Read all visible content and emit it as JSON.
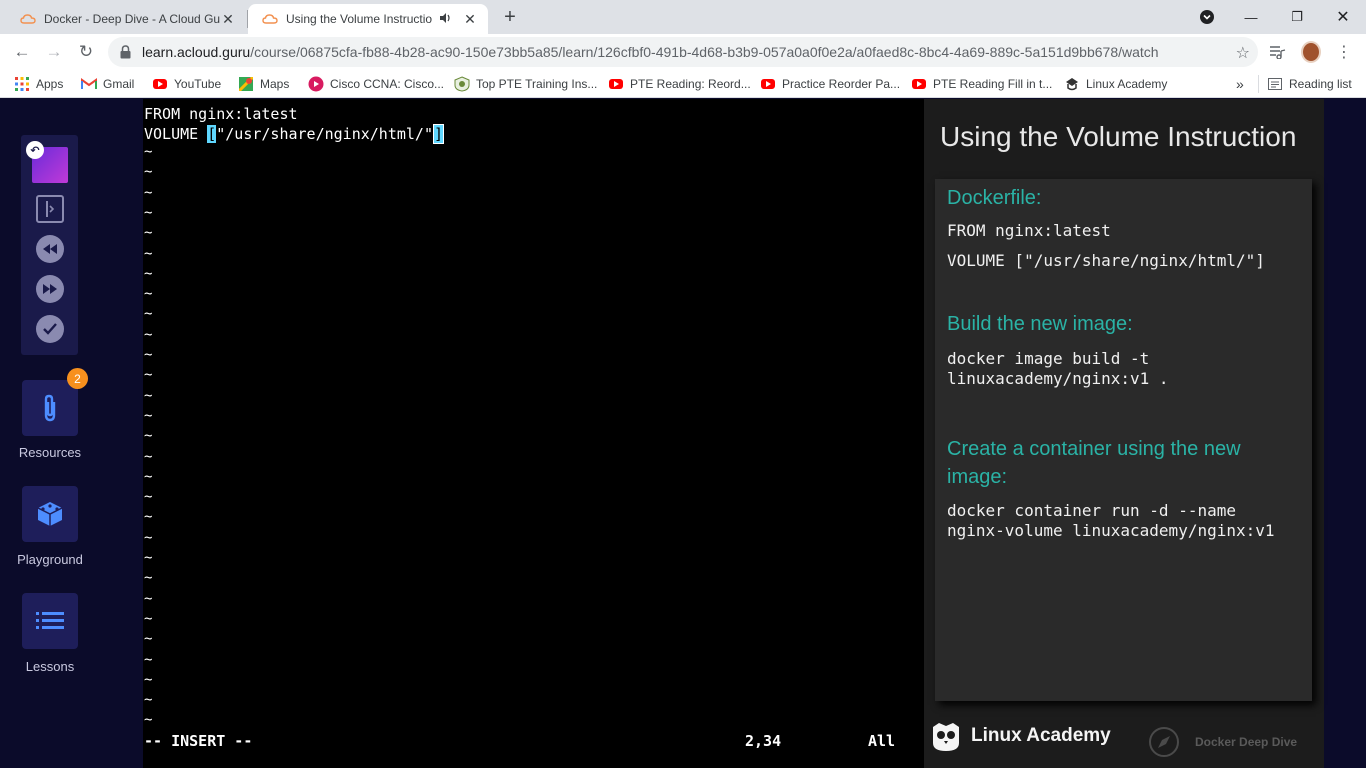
{
  "browser": {
    "tabs": [
      {
        "title": "Docker - Deep Dive - A Cloud Gu",
        "active": false
      },
      {
        "title": "Using the Volume Instructio",
        "active": true,
        "audio": true
      }
    ],
    "url_host": "learn.acloud.guru",
    "url_path": "/course/06875cfa-fb88-4b28-ac90-150e73bb5a85/learn/126cfbf0-491b-4d68-b3b9-057a0a0f0e2a/a0faed8c-8bc4-4a69-889c-5a151d9bb678/watch"
  },
  "bookmarks": {
    "items": [
      {
        "label": "Apps",
        "icon": "apps-grid-icon"
      },
      {
        "label": "Gmail",
        "icon": "gmail-icon"
      },
      {
        "label": "YouTube",
        "icon": "youtube-icon"
      },
      {
        "label": "Maps",
        "icon": "maps-icon"
      },
      {
        "label": "Cisco CCNA: Cisco...",
        "icon": "cisco-icon"
      },
      {
        "label": "Top PTE Training Ins...",
        "icon": "pte-icon"
      },
      {
        "label": "PTE Reading: Reord...",
        "icon": "youtube-icon"
      },
      {
        "label": "Practice Reorder Pa...",
        "icon": "youtube-icon"
      },
      {
        "label": "PTE Reading Fill in t...",
        "icon": "youtube-icon"
      },
      {
        "label": "Linux Academy",
        "icon": "linux-academy-icon"
      }
    ],
    "overflow": "»",
    "reading_list": "Reading list"
  },
  "leftnav": {
    "badge_count": "2",
    "resources_label": "Resources",
    "playground_label": "Playground",
    "lessons_label": "Lessons"
  },
  "terminal": {
    "line1": "FROM nginx:latest",
    "line2_prefix": "VOLUME ",
    "line2_bracket_open": "[",
    "line2_middle": "\"/usr/share/nginx/html/\"",
    "line2_bracket_close": "]",
    "tilde": "~",
    "mode": "-- INSERT --",
    "position": "2,34",
    "scroll": "All"
  },
  "slide": {
    "title": "Using the Volume Instruction",
    "dockerfile_heading": "Dockerfile:",
    "dockerfile_code": "FROM nginx:latest\n\nVOLUME [\"/usr/share/nginx/html/\"]",
    "build_heading": "Build the new image:",
    "build_code": "docker image build -t\nlinuxacademy/nginx:v1 .",
    "create_heading": "Create a container using the new\nimage:",
    "create_code": "docker container run -d --name\nnginx-volume linuxacademy/nginx:v1",
    "brand": "Linux Academy",
    "course_watermark": "Docker Deep Dive"
  },
  "colors": {
    "accent_teal": "#2ab3a6",
    "vim_cursor": "#5fd7ff",
    "badge_orange": "#f7901e",
    "nav_bg": "#0b0b2a"
  }
}
